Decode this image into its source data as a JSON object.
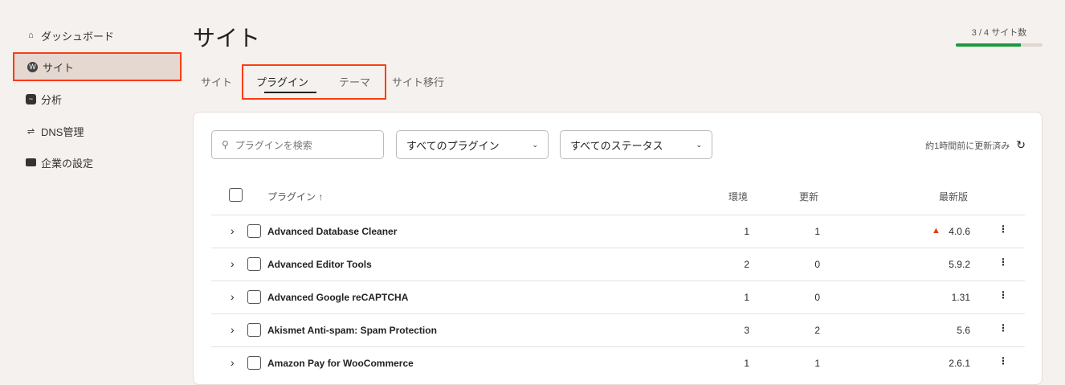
{
  "sidebar": {
    "items": [
      {
        "label": "ダッシュボード",
        "icon": "home-icon"
      },
      {
        "label": "サイト",
        "icon": "wordpress-icon"
      },
      {
        "label": "分析",
        "icon": "analytics-icon"
      },
      {
        "label": "DNS管理",
        "icon": "dns-icon"
      },
      {
        "label": "企業の設定",
        "icon": "briefcase-icon"
      }
    ]
  },
  "header": {
    "title": "サイト",
    "quota_label": "3 / 4 サイト数",
    "quota_fraction": 0.75
  },
  "tabs": [
    "サイト",
    "プラグイン",
    "テーマ",
    "サイト移行"
  ],
  "toolbar": {
    "search_placeholder": "プラグインを検索",
    "filter_plugins": "すべてのプラグイン",
    "filter_status": "すべてのステータス",
    "updated": "約1時間前に更新済み"
  },
  "table": {
    "headers": {
      "plugin": "プラグイン ↑",
      "env": "環境",
      "updates": "更新",
      "latest": "最新版"
    },
    "rows": [
      {
        "name": "Advanced Database Cleaner",
        "env": "1",
        "updates": "1",
        "latest": "4.0.6",
        "warning": true
      },
      {
        "name": "Advanced Editor Tools",
        "env": "2",
        "updates": "0",
        "latest": "5.9.2"
      },
      {
        "name": "Advanced Google reCAPTCHA",
        "env": "1",
        "updates": "0",
        "latest": "1.31"
      },
      {
        "name": "Akismet Anti-spam: Spam Protection",
        "env": "3",
        "updates": "2",
        "latest": "5.6"
      },
      {
        "name": "Amazon Pay for WooCommerce",
        "env": "1",
        "updates": "1",
        "latest": "2.6.1"
      }
    ]
  },
  "colors": {
    "accent": "#ff3b12",
    "progress": "#1a9a3c"
  }
}
